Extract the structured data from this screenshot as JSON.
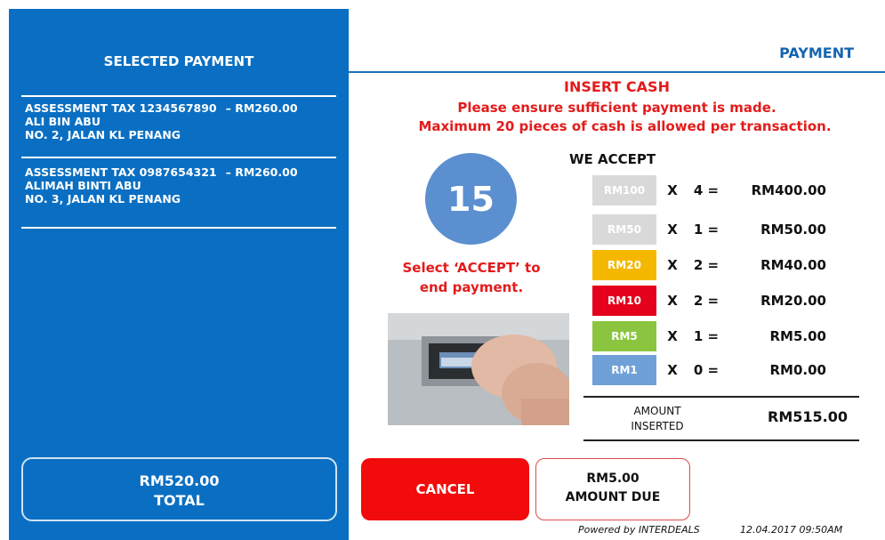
{
  "left": {
    "title": "SELECTED PAYMENT",
    "items": [
      {
        "description": "ASSESSMENT TAX 1234567890",
        "amount": "– RM260.00",
        "name": "ALI BIN ABU",
        "address": "NO. 2, JALAN KL PENANG"
      },
      {
        "description": "ASSESSMENT TAX 0987654321",
        "amount": "– RM260.00",
        "name": "ALIMAH BINTI ABU",
        "address": "NO. 3, JALAN KL PENANG"
      }
    ],
    "total_amount": "RM520.00",
    "total_label": "TOTAL"
  },
  "header": {
    "title": "PAYMENT"
  },
  "instructions": {
    "heading": "INSERT CASH",
    "line1": "Please ensure sufficient payment is made.",
    "line2": "Maximum 20 pieces of cash is allowed per transaction."
  },
  "timer": {
    "seconds": "15"
  },
  "select_text": {
    "line1": "Select ‘ACCEPT’ to",
    "line2": "end payment."
  },
  "accept": {
    "title": "WE ACCEPT",
    "rows": [
      {
        "note": "RM100",
        "x": "X",
        "qty": "4 =",
        "subtotal": "RM400.00",
        "color": "#d9d9d9"
      },
      {
        "note": "RM50",
        "x": "X",
        "qty": "1 =",
        "subtotal": "RM50.00",
        "color": "#d9d9d9"
      },
      {
        "note": "RM20",
        "x": "X",
        "qty": "2 =",
        "subtotal": "RM40.00",
        "color": "#f5b800"
      },
      {
        "note": "RM10",
        "x": "X",
        "qty": "2 =",
        "subtotal": "RM20.00",
        "color": "#e5001b"
      },
      {
        "note": "RM5",
        "x": "X",
        "qty": "1 =",
        "subtotal": "RM5.00",
        "color": "#8bc53f"
      },
      {
        "note": "RM1",
        "x": "X",
        "qty": "0 =",
        "subtotal": "RM0.00",
        "color": "#6fa1d8"
      }
    ],
    "amount_inserted_label_1": "AMOUNT",
    "amount_inserted_label_2": "INSERTED",
    "amount_inserted_value": "RM515.00"
  },
  "buttons": {
    "cancel_label": "CANCEL",
    "due_amount": "RM5.00",
    "due_label": "AMOUNT DUE"
  },
  "footer": {
    "powered_by": "Powered by INTERDEALS",
    "datetime": "12.04.2017 09:50AM"
  },
  "colors": {
    "left_panel": "#0a6fc2",
    "accent_red": "#e41b1b",
    "cancel_red": "#f10b0b",
    "timer_blue": "#5b8fcf",
    "title_blue": "#1565b0"
  },
  "icons": {
    "cash_slot": "cash-insert-photo"
  }
}
